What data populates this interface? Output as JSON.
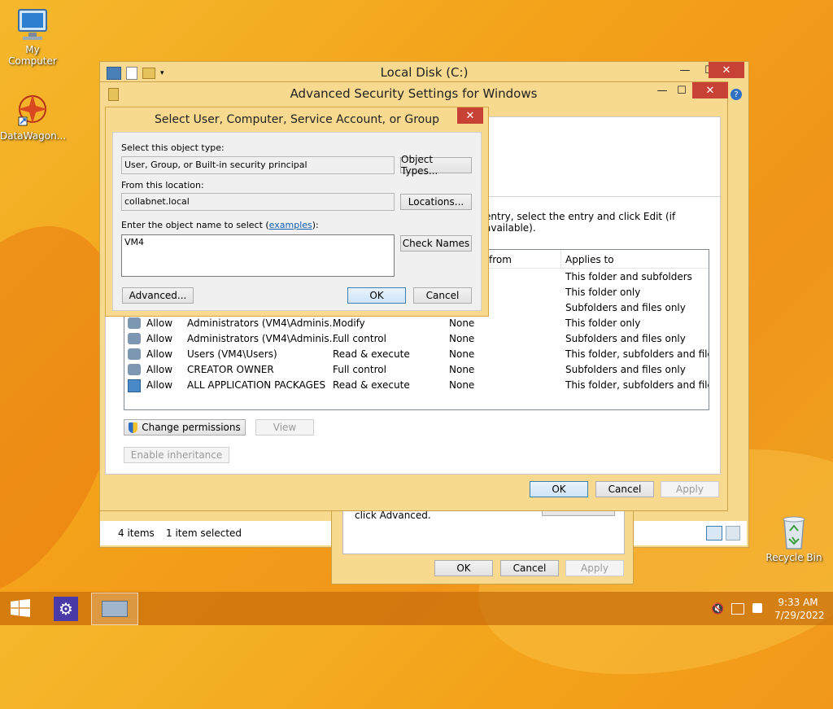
{
  "desktop": {
    "icons": [
      {
        "label": "My Computer"
      },
      {
        "label": "DataWagon..."
      },
      {
        "label": "Recycle Bin"
      }
    ]
  },
  "explorer": {
    "title": "Local Disk (C:)",
    "status_items": "4 items",
    "status_selected": "1 item selected"
  },
  "props_back": {
    "text": "click Advanced.",
    "ok": "OK",
    "cancel": "Cancel",
    "apply": "Apply"
  },
  "advanced": {
    "title": "Advanced Security Settings for Windows",
    "instruction": "entry, select the entry and click Edit (if available).",
    "col_from": "from",
    "col_applies": "Applies to",
    "partial_rows": [
      {
        "applies": "This folder and subfolders"
      },
      {
        "applies": "This folder only"
      },
      {
        "applies": "Subfolders and files only"
      }
    ],
    "rows": [
      {
        "type": "Allow",
        "principal": "Administrators (VM4\\Adminis...",
        "access": "Modify",
        "inherited": "None",
        "applies": "This folder only"
      },
      {
        "type": "Allow",
        "principal": "Administrators (VM4\\Adminis...",
        "access": "Full control",
        "inherited": "None",
        "applies": "Subfolders and files only"
      },
      {
        "type": "Allow",
        "principal": "Users (VM4\\Users)",
        "access": "Read & execute",
        "inherited": "None",
        "applies": "This folder, subfolders and files"
      },
      {
        "type": "Allow",
        "principal": "CREATOR OWNER",
        "access": "Full control",
        "inherited": "None",
        "applies": "Subfolders and files only"
      },
      {
        "type": "Allow",
        "principal": "ALL APPLICATION PACKAGES",
        "access": "Read & execute",
        "inherited": "None",
        "applies": "This folder, subfolders and files"
      }
    ],
    "change_permissions": "Change permissions",
    "view": "View",
    "enable_inheritance": "Enable inheritance",
    "ok": "OK",
    "cancel": "Cancel",
    "apply": "Apply"
  },
  "select_dialog": {
    "title": "Select User, Computer, Service Account, or Group",
    "object_type_label": "Select this object type:",
    "object_type_value": "User, Group, or Built-in security principal",
    "object_types_btn": "Object Types...",
    "location_label": "From this location:",
    "location_value": "collabnet.local",
    "locations_btn": "Locations...",
    "name_label_prefix": "Enter the object name to select (",
    "name_label_link": "examples",
    "name_label_suffix": "):",
    "name_value": "VM4",
    "check_names_btn": "Check Names",
    "advanced_btn": "Advanced...",
    "ok": "OK",
    "cancel": "Cancel"
  },
  "taskbar": {
    "time": "9:33 AM",
    "date": "7/29/2022"
  }
}
